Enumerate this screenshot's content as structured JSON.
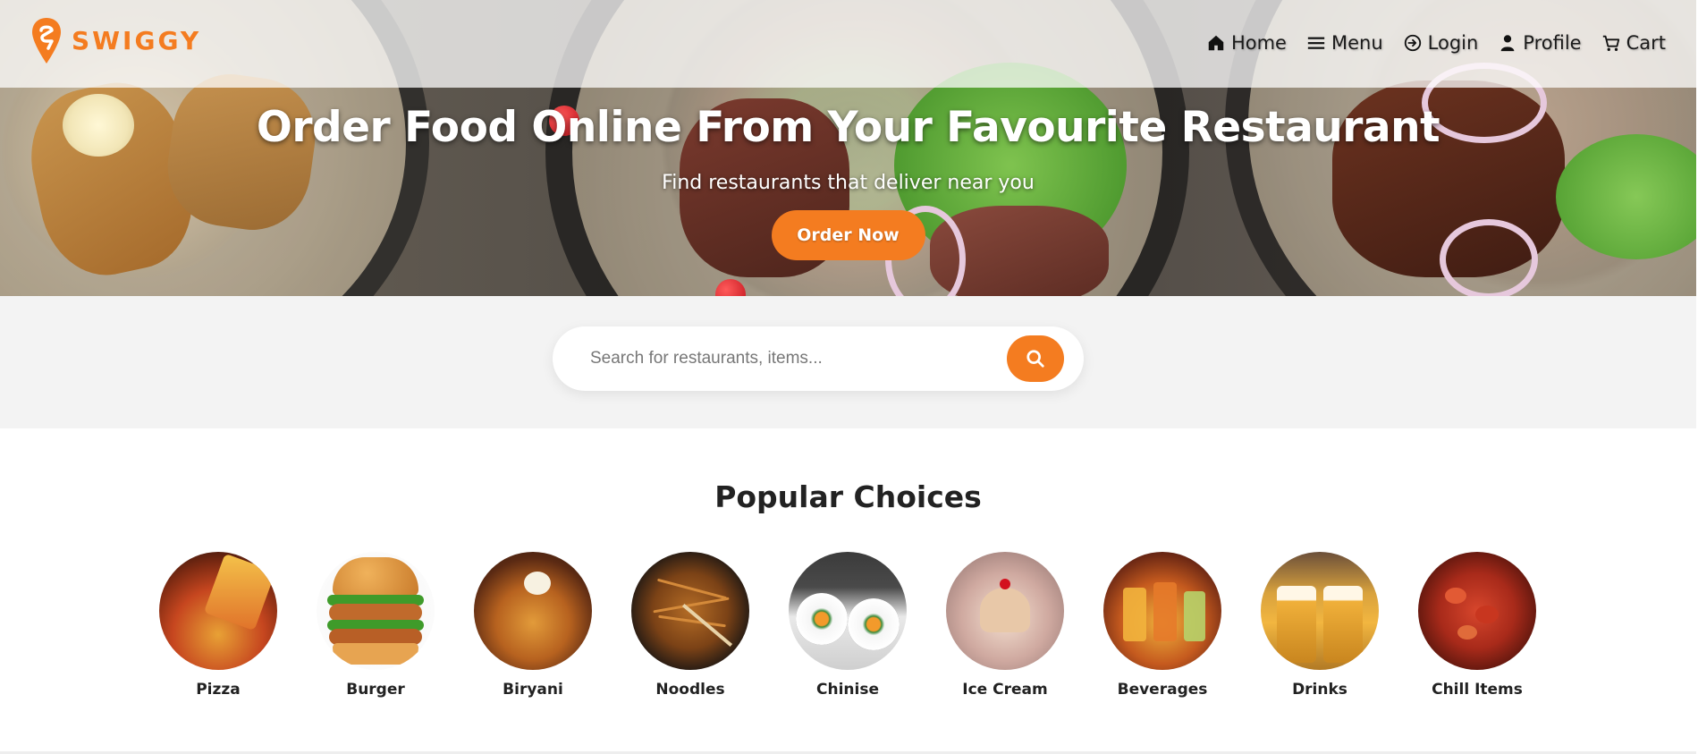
{
  "brand": {
    "name": "SWIGGY",
    "color": "#f47c20",
    "icon": "swiggy-logo"
  },
  "nav": {
    "items": [
      {
        "label": "Home",
        "icon": "home-icon"
      },
      {
        "label": "Menu",
        "icon": "hamburger-icon"
      },
      {
        "label": "Login",
        "icon": "login-icon"
      },
      {
        "label": "Profile",
        "icon": "user-icon"
      },
      {
        "label": "Cart",
        "icon": "cart-icon"
      }
    ]
  },
  "hero": {
    "title": "Order Food Online From Your Favourite Restaurant",
    "subtitle": "Find restaurants that deliver near you",
    "cta_label": "Order Now"
  },
  "search": {
    "placeholder": "Search for restaurants, items...",
    "value": "",
    "button_icon": "search-icon"
  },
  "popular": {
    "title": "Popular Choices",
    "items": [
      {
        "label": "Pizza"
      },
      {
        "label": "Burger"
      },
      {
        "label": "Biryani"
      },
      {
        "label": "Noodles"
      },
      {
        "label": "Chinise"
      },
      {
        "label": "Ice Cream"
      },
      {
        "label": "Beverages"
      },
      {
        "label": "Drinks"
      },
      {
        "label": "Chill Items"
      }
    ]
  },
  "colors": {
    "accent": "#f47c20",
    "search_band": "#f3f3f3",
    "text": "#222222"
  }
}
